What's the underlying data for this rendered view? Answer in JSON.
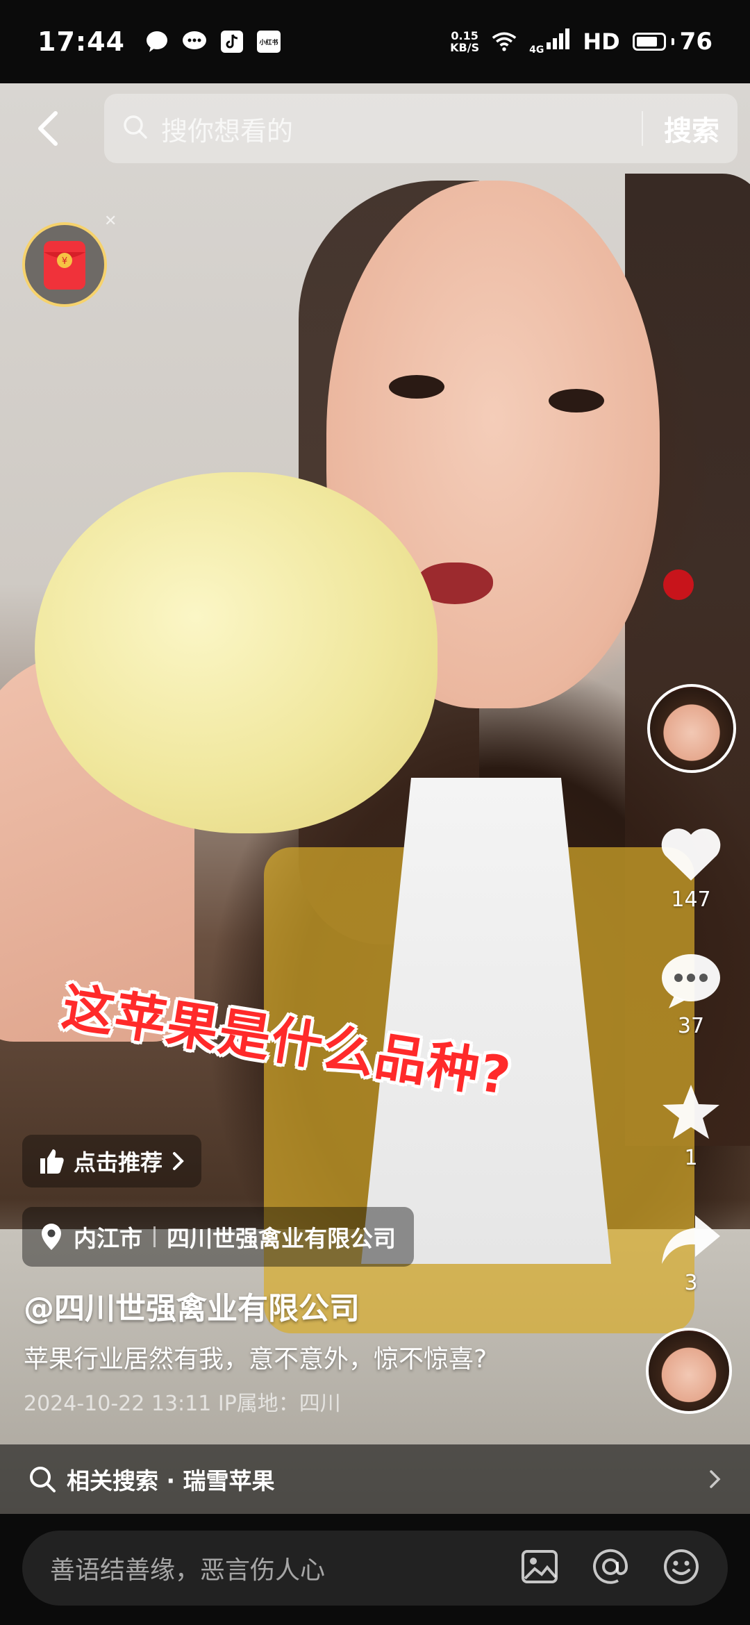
{
  "status_bar": {
    "time": "17:44",
    "net_speed_value": "0.15",
    "net_speed_unit": "KB/S",
    "network": "4G",
    "hd": "HD",
    "battery": "76",
    "app_badge": "小红书"
  },
  "top_bar": {
    "search_placeholder": "搜你想看的",
    "search_button": "搜索"
  },
  "video": {
    "caption_overlay": "这苹果是什么品种?"
  },
  "actions": {
    "likes": "147",
    "comments": "37",
    "favorites": "1",
    "shares": "3"
  },
  "info": {
    "recommend_label": "点击推荐",
    "location_city": "内江市",
    "location_name": "四川世强禽业有限公司",
    "author": "@四川世强禽业有限公司",
    "description": "苹果行业居然有我，意不意外，惊不惊喜?",
    "meta": "2024-10-22 13:11  IP属地：四川"
  },
  "related_search": {
    "label": "相关搜索 · 瑞雪苹果"
  },
  "comment_bar": {
    "placeholder": "善语结善缘，恶言伤人心"
  },
  "colors": {
    "caption_red": "#ff2a2a",
    "red_packet_border": "#f6d26c"
  }
}
